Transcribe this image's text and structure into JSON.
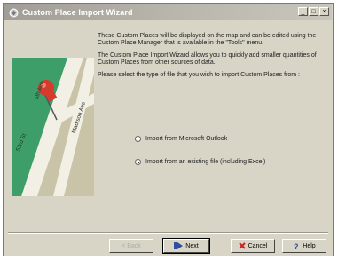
{
  "window": {
    "title": "Custom Place Import Wizard",
    "controls": {
      "minimize": "_",
      "maximize": "□",
      "close": "×"
    }
  },
  "description": {
    "paragraph1": "These Custom Places will be displayed on the map and can be edited using the Custom Place Manager that is available in the \"Tools\" menu.",
    "paragraph2": "The Custom Place Import Wizard allows you to quickly add smaller quantities of Custom Places from other sources of data.",
    "paragraph3": "Please select the type of file that you wish to import Custom Places from :"
  },
  "options": [
    {
      "label": "Import from Microsoft Outlook",
      "selected": false
    },
    {
      "label": "Import from an existing file (including Excel)",
      "selected": true
    }
  ],
  "map": {
    "streets": [
      "53rd St",
      "5th Ave",
      "Madison Ave"
    ],
    "colors": {
      "park": "#3e9e6a",
      "road": "#f2f0e4",
      "block": "#c9c3a8",
      "pin": "#d63a2c"
    }
  },
  "buttons": {
    "back": "< Back",
    "next": "Next",
    "cancel": "Cancel",
    "help": "Help"
  }
}
